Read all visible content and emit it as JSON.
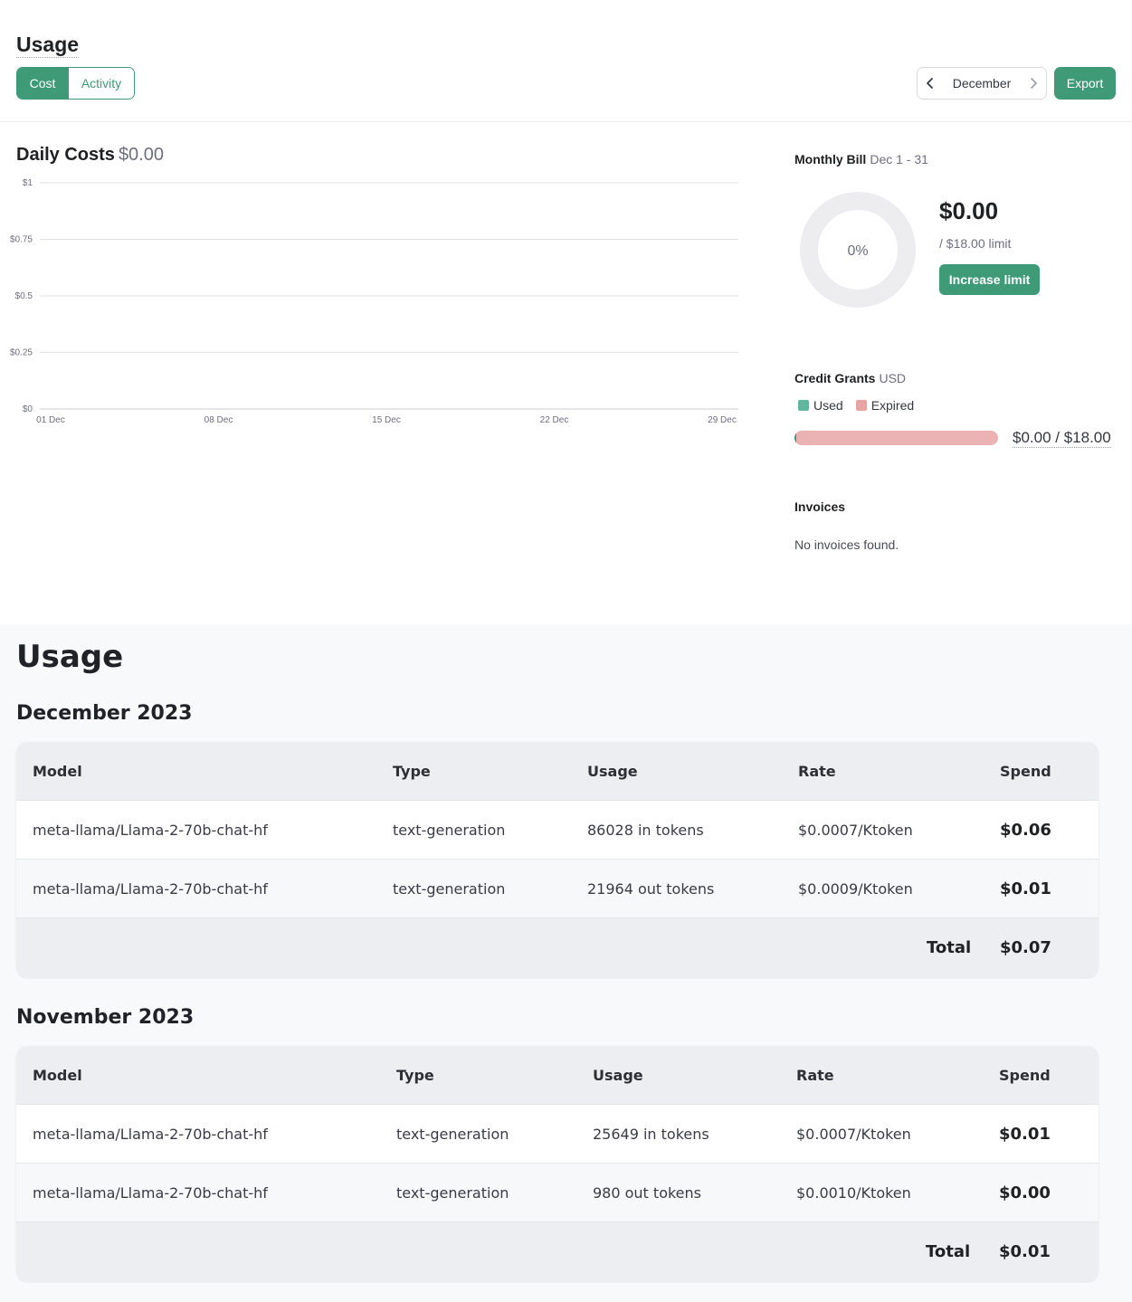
{
  "header": {
    "title": "Usage",
    "tabs": [
      {
        "label": "Cost",
        "active": true
      },
      {
        "label": "Activity",
        "active": false
      }
    ],
    "month": "December",
    "export_label": "Export"
  },
  "daily_costs": {
    "title": "Daily Costs",
    "amount": "$0.00"
  },
  "chart_data": {
    "type": "bar",
    "categories": [
      "01 Dec",
      "08 Dec",
      "15 Dec",
      "22 Dec",
      "29 Dec"
    ],
    "values": [
      0,
      0,
      0,
      0,
      0
    ],
    "y_ticks": [
      "$0",
      "$0.25",
      "$0.5",
      "$0.75",
      "$1"
    ],
    "ylim": [
      0,
      1
    ],
    "grid": true
  },
  "monthly_bill": {
    "title": "Monthly Bill",
    "range": "Dec 1 - 31",
    "percent_label": "0%",
    "percent": 0,
    "amount": "$0.00",
    "limit": "/ $18.00 limit",
    "increase_label": "Increase limit"
  },
  "credit_grants": {
    "title": "Credit Grants",
    "currency": "USD",
    "legend": [
      {
        "label": "Used",
        "color": "#5fb89b"
      },
      {
        "label": "Expired",
        "color": "#e8a3a3"
      }
    ],
    "used_fraction": 0.005,
    "amount": "$0.00 / $18.00"
  },
  "invoices": {
    "title": "Invoices",
    "empty": "No invoices found."
  },
  "usage": {
    "title": "Usage",
    "columns": [
      "Model",
      "Type",
      "Usage",
      "Rate",
      "Spend"
    ],
    "months": [
      {
        "name": "December 2023",
        "rows": [
          [
            "meta-llama/Llama-2-70b-chat-hf",
            "text-generation",
            "86028 in tokens",
            "$0.0007/Ktoken",
            "$0.06"
          ],
          [
            "meta-llama/Llama-2-70b-chat-hf",
            "text-generation",
            "21964 out tokens",
            "$0.0009/Ktoken",
            "$0.01"
          ]
        ],
        "total_label": "Total",
        "total": "$0.07"
      },
      {
        "name": "November 2023",
        "rows": [
          [
            "meta-llama/Llama-2-70b-chat-hf",
            "text-generation",
            "25649 in tokens",
            "$0.0007/Ktoken",
            "$0.01"
          ],
          [
            "meta-llama/Llama-2-70b-chat-hf",
            "text-generation",
            "980 out tokens",
            "$0.0010/Ktoken",
            "$0.00"
          ]
        ],
        "total_label": "Total",
        "total": "$0.01"
      }
    ]
  },
  "colors": {
    "accent": "#3e9a77",
    "expired": "#eab2b2",
    "donut_track": "#ededf0"
  }
}
